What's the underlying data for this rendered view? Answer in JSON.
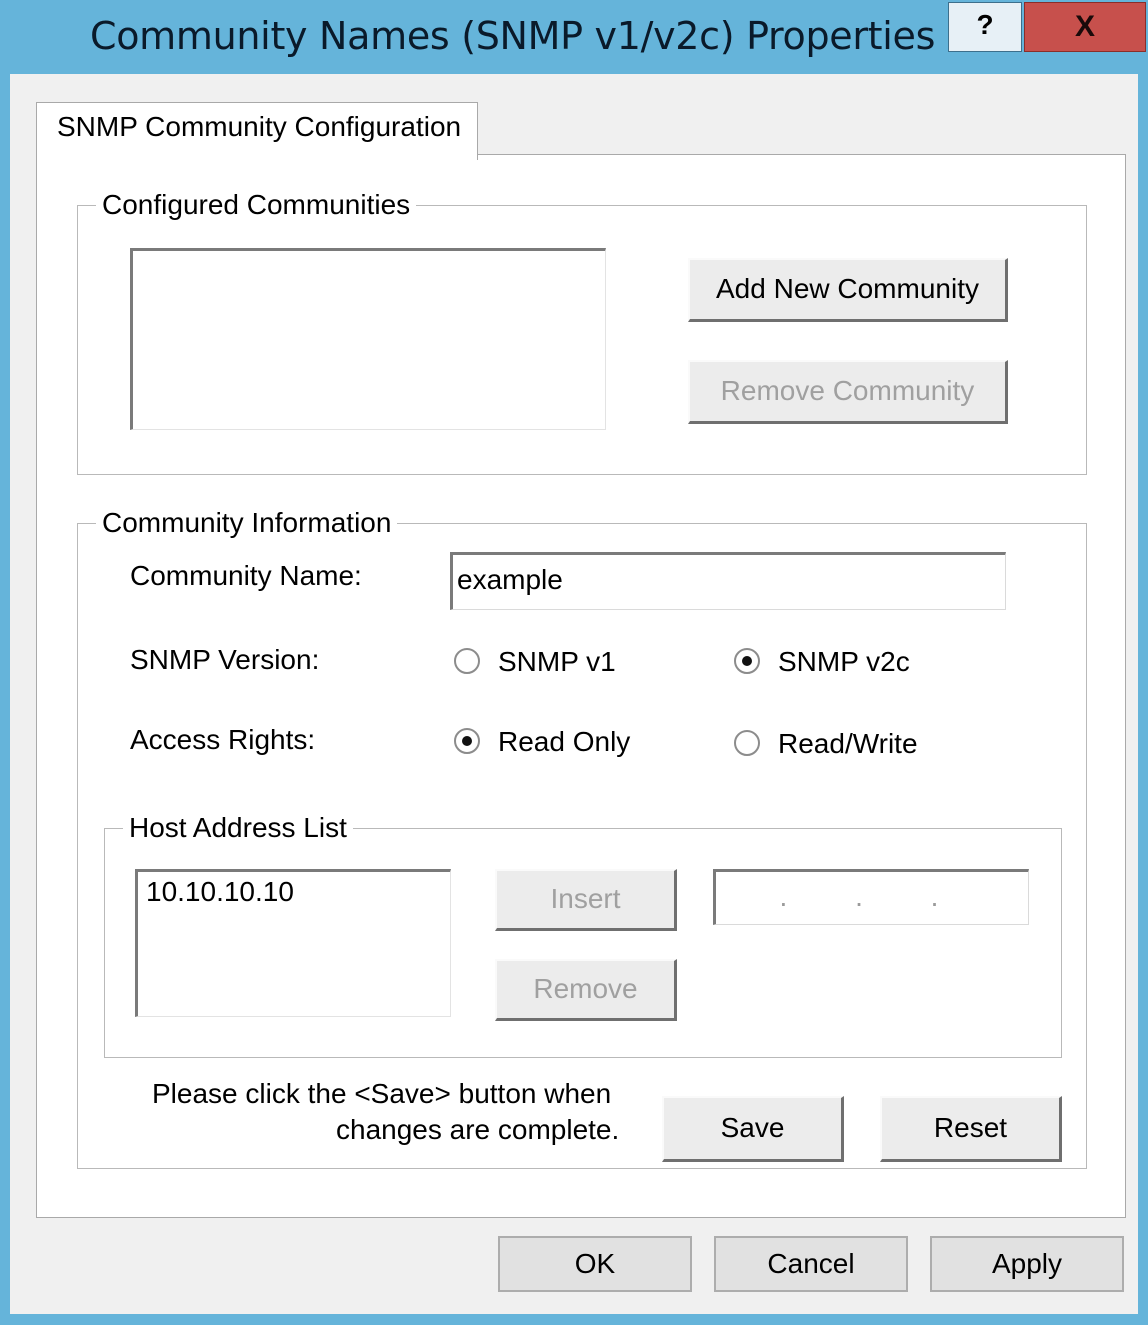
{
  "window": {
    "title": "Community Names (SNMP v1/v2c) Properties",
    "help_label": "?",
    "close_label": "X"
  },
  "tab": {
    "label": "SNMP Community Configuration"
  },
  "configured": {
    "legend": "Configured Communities",
    "items": [],
    "add_label": "Add New Community",
    "remove_label": "Remove Community"
  },
  "info": {
    "legend": "Community Information",
    "name_label": "Community Name:",
    "name_value": "example",
    "version_label": "SNMP Version:",
    "version_v1": "SNMP v1",
    "version_v2c": "SNMP v2c",
    "version_selected": "SNMP v2c",
    "access_label": "Access Rights:",
    "access_ro": "Read Only",
    "access_rw": "Read/Write",
    "access_selected": "Read Only"
  },
  "hosts": {
    "legend": "Host Address List",
    "items": [
      "10.10.10.10"
    ],
    "insert_label": "Insert",
    "remove_label": "Remove",
    "ip_input_value": ". . ."
  },
  "save_note": {
    "line1": "Please click the <Save> button when",
    "line2": "changes are complete."
  },
  "actions": {
    "save": "Save",
    "reset": "Reset"
  },
  "footer": {
    "ok": "OK",
    "cancel": "Cancel",
    "apply": "Apply"
  }
}
